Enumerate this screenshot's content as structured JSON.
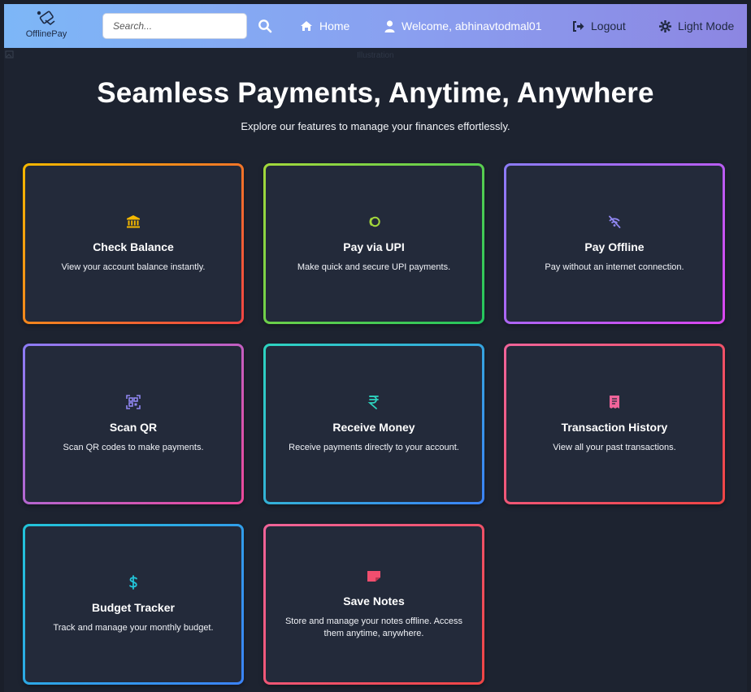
{
  "navbar": {
    "logo_text": "OfflinePay",
    "search_placeholder": "Search...",
    "home_label": "Home",
    "welcome_label": "Welcome, abhinavtodmal01",
    "logout_label": "Logout",
    "theme_label": "Light Mode"
  },
  "illustration_alt": "Illustration",
  "hero": {
    "title": "Seamless Payments, Anytime, Anywhere",
    "subtitle": "Explore our features to manage your finances effortlessly."
  },
  "cards": [
    {
      "title": "Check Balance",
      "desc": "View your account balance instantly.",
      "icon": "bank-icon",
      "icon_color": "#f5b800"
    },
    {
      "title": "Pay via UPI",
      "desc": "Make quick and secure UPI payments.",
      "icon": "upi-icon",
      "icon_color": "#a4d83b"
    },
    {
      "title": "Pay Offline",
      "desc": "Pay without an internet connection.",
      "icon": "offline-signal-icon",
      "icon_color": "#8f86f0"
    },
    {
      "title": "Scan QR",
      "desc": "Scan QR codes to make payments.",
      "icon": "qr-scan-icon",
      "icon_color": "#8f86f0"
    },
    {
      "title": "Receive Money",
      "desc": "Receive payments directly to your account.",
      "icon": "rupee-icon",
      "icon_color": "#2dd4bf"
    },
    {
      "title": "Transaction History",
      "desc": "View all your past transactions.",
      "icon": "receipt-icon",
      "icon_color": "#f0649a"
    },
    {
      "title": "Budget Tracker",
      "desc": "Track and manage your monthly budget.",
      "icon": "dollar-icon",
      "icon_color": "#22c4d8"
    },
    {
      "title": "Save Notes",
      "desc": "Store and manage your notes offline. Access them anytime, anywhere.",
      "icon": "note-icon",
      "icon_color": "#f04e6e"
    }
  ],
  "colors": {
    "navbar_gradient": [
      "#7db7f7",
      "#8c86e2"
    ],
    "page_background": "#1d2330",
    "card_background": "#232a3a",
    "card_borders": [
      [
        "#f5b800",
        "#ef4444"
      ],
      [
        "#a4d83b",
        "#22c55e"
      ],
      [
        "#8b7cf6",
        "#d946ef"
      ],
      [
        "#8b7cf6",
        "#ec4899"
      ],
      [
        "#2dd4bf",
        "#3b82f6"
      ],
      [
        "#f0649a",
        "#ef4444"
      ],
      [
        "#22c4d8",
        "#3b82f6"
      ],
      [
        "#f0649a",
        "#ef4444"
      ]
    ]
  }
}
